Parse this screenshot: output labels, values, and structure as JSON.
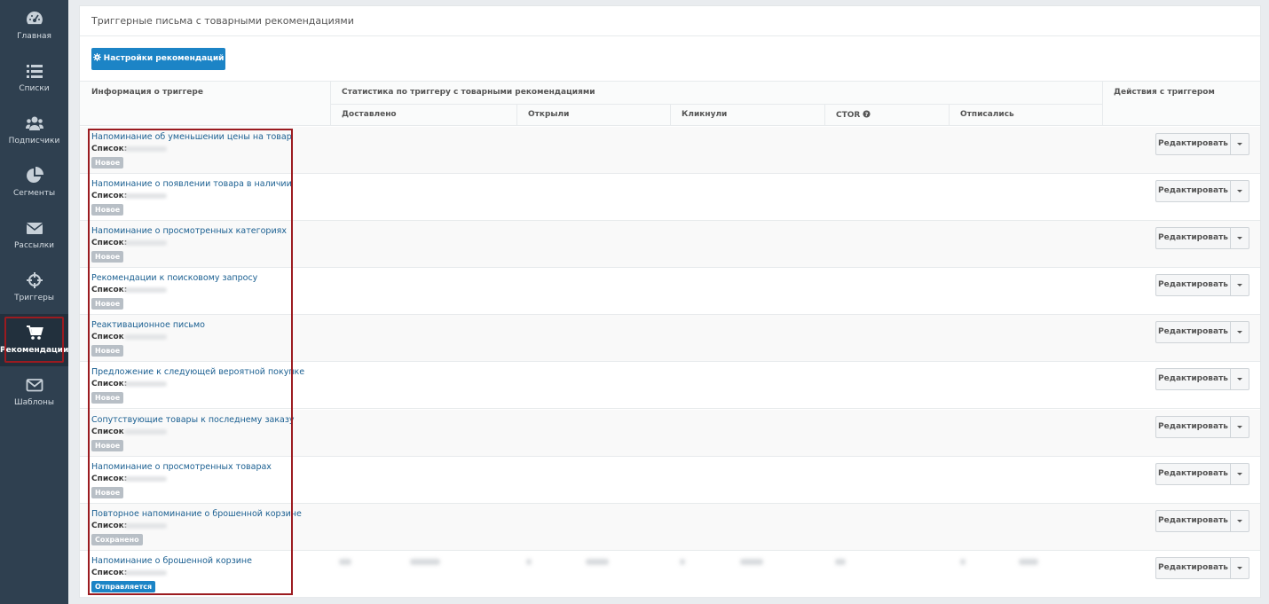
{
  "sidebar": {
    "items": [
      {
        "label": "Главная",
        "icon": "dashboard-icon"
      },
      {
        "label": "Списки",
        "icon": "list-icon"
      },
      {
        "label": "Подписчики",
        "icon": "users-icon"
      },
      {
        "label": "Сегменты",
        "icon": "pie-chart-icon"
      },
      {
        "label": "Рассылки",
        "icon": "envelope-icon"
      },
      {
        "label": "Триггеры",
        "icon": "crosshairs-icon"
      },
      {
        "label": "Рекомендации",
        "icon": "cart-icon",
        "active": true
      },
      {
        "label": "Шаблоны",
        "icon": "envelope-outline-icon"
      }
    ]
  },
  "panel": {
    "title": "Триггерные письма с товарными рекомендациями",
    "settings_button": "Настройки рекомендаций"
  },
  "table": {
    "headers": {
      "info": "Информация о триггере",
      "stats": "Статистика по триггеру с товарными рекомендациями",
      "actions": "Действия с триггером",
      "delivered": "Доставлено",
      "opened": "Открыли",
      "clicked": "Кликнули",
      "ctor": "CTOR",
      "unsubscribed": "Отписались"
    },
    "edit_label": "Редактировать",
    "rows": [
      {
        "name": "Напоминание об уменьшении цены на товар",
        "list_label": "Список:",
        "status": "Новое",
        "status_color": "#b8bfc6"
      },
      {
        "name": "Напоминание о появлении товара в наличии",
        "list_label": "Список:",
        "status": "Новое",
        "status_color": "#b8bfc6"
      },
      {
        "name": "Напоминание о просмотренных категориях",
        "list_label": "Список:",
        "status": "Новое",
        "status_color": "#b8bfc6"
      },
      {
        "name": "Рекомендации к поисковому запросу",
        "list_label": "Список:",
        "status": "Новое",
        "status_color": "#b8bfc6"
      },
      {
        "name": "Реактивационное письмо",
        "list_label": "Список",
        "status": "Новое",
        "status_color": "#b8bfc6"
      },
      {
        "name": "Предложение к следующей вероятной покупке",
        "list_label": "Список:",
        "status": "Новое",
        "status_color": "#b8bfc6"
      },
      {
        "name": "Сопутствующие товары к последнему заказу",
        "list_label": "Список",
        "status": "Новое",
        "status_color": "#b8bfc6"
      },
      {
        "name": "Напоминание о просмотренных товарах",
        "list_label": "Список:",
        "status": "Новое",
        "status_color": "#b8bfc6"
      },
      {
        "name": "Повторное напоминание о брошенной корзине",
        "list_label": "Список:",
        "status": "Сохранено",
        "status_color": "#b8bfc6"
      },
      {
        "name": "Напоминание о брошенной корзине",
        "list_label": "Список:",
        "status": "Отправляется",
        "status_color": "#1c84c6"
      }
    ]
  },
  "colors": {
    "sidebar_bg": "#2f4050",
    "primary": "#1c84c6",
    "link": "#1a5f91",
    "highlight": "#9b1b20"
  }
}
